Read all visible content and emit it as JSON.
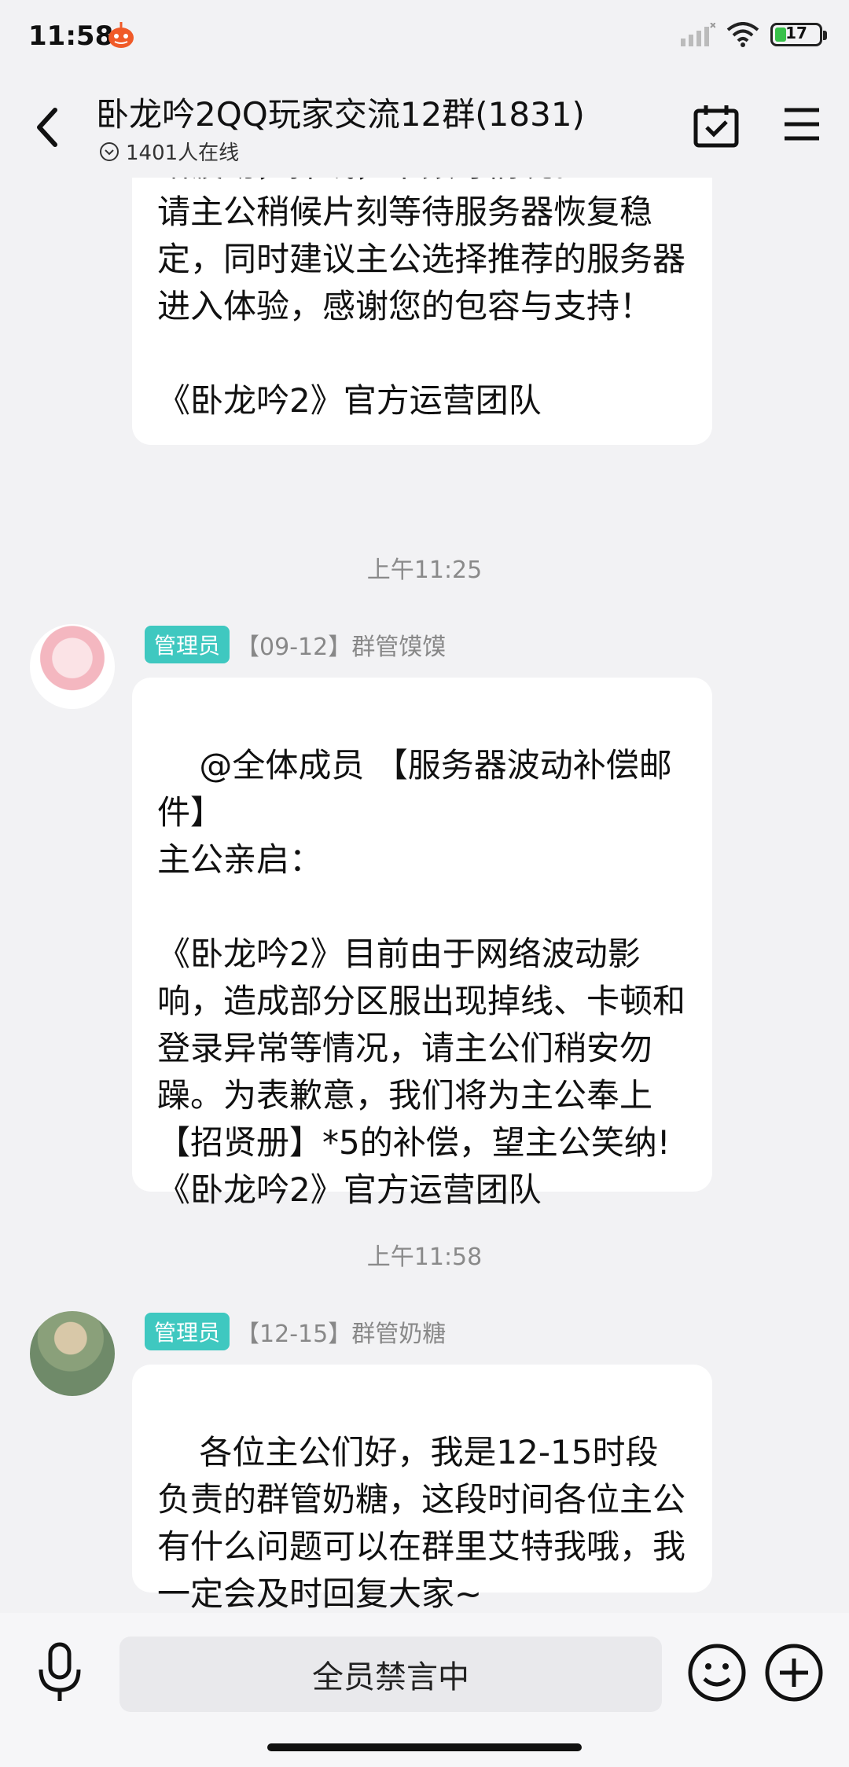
{
  "status_bar": {
    "time": "11:58",
    "battery": "17"
  },
  "header": {
    "title": "卧龙吟2QQ玩家交流12群(1831)",
    "online": "1401人在线"
  },
  "messages": [
    {
      "text": "络波动，掉线，卡频等情况。\n请主公稍候片刻等待服务器恢复稳定，同时建议主公选择推荐的服务器进入体验，感谢您的包容与支持！\n\n《卧龙吟2》官方运营团队"
    },
    {
      "timestamp": "上午11:25",
      "badge": "管理员",
      "sender": "【09-12】群管馍馍",
      "text": "@全体成员 【服务器波动补偿邮件】\n主公亲启：\n\n《卧龙吟2》目前由于网络波动影响，造成部分区服出现掉线、卡顿和登录异常等情况，请主公们稍安勿躁。为表歉意，我们将为主公奉上【招贤册】*5的补偿，望主公笑纳!《卧龙吟2》官方运营团队"
    },
    {
      "timestamp": "上午11:58",
      "badge": "管理员",
      "sender": "【12-15】群管奶糖",
      "text": "各位主公们好，我是12-15时段负责的群管奶糖，这段时间各位主公有什么问题可以在群里艾特我哦，我一定会及时回复大家~"
    }
  ],
  "input": {
    "label": "全员禁言中"
  },
  "icons": {
    "back": "back-arrow-icon",
    "calendar": "calendar-check-icon",
    "menu": "hamburger-menu-icon",
    "mic": "microphone-icon",
    "emoji": "emoji-icon",
    "plus": "plus-icon"
  },
  "colors": {
    "badge": "#3fc8c0",
    "battery": "#38c14a",
    "background": "#f2f2f4"
  }
}
